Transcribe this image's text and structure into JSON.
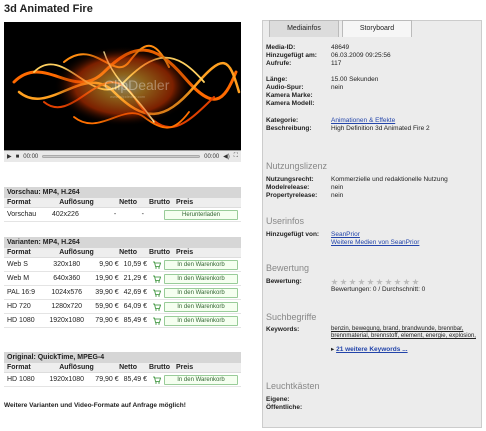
{
  "page_title": "3d Animated Fire",
  "player": {
    "watermark": "ClipDealer",
    "watermark_sub": "www.clipdealer.com",
    "time_start": "00:00",
    "time_end": "00:00"
  },
  "preview": {
    "heading": "Vorschau: MP4, H.264",
    "cols": [
      "Format",
      "Auflösung",
      "Netto",
      "Brutto",
      "Preis"
    ],
    "row": {
      "format": "Vorschau",
      "res": "402x226",
      "netto": "-",
      "brutto": "-",
      "btn": "Herunterladen"
    }
  },
  "variants": {
    "heading": "Varianten: MP4, H.264",
    "cols": [
      "Format",
      "Auflösung",
      "Netto",
      "Brutto",
      "Preis"
    ],
    "rows": [
      {
        "format": "Web S",
        "res": "320x180",
        "netto": "9,90 €",
        "brutto": "10,59 €",
        "btn": "In den Warenkorb"
      },
      {
        "format": "Web M",
        "res": "640x360",
        "netto": "19,90 €",
        "brutto": "21,29 €",
        "btn": "In den Warenkorb"
      },
      {
        "format": "PAL 16:9",
        "res": "1024x576",
        "netto": "39,90 €",
        "brutto": "42,69 €",
        "btn": "In den Warenkorb"
      },
      {
        "format": "HD 720",
        "res": "1280x720",
        "netto": "59,90 €",
        "brutto": "64,09 €",
        "btn": "In den Warenkorb"
      },
      {
        "format": "HD 1080",
        "res": "1920x1080",
        "netto": "79,90 €",
        "brutto": "85,49 €",
        "btn": "In den Warenkorb"
      }
    ]
  },
  "original": {
    "heading": "Original: QuickTime, MPEG-4",
    "cols": [
      "Format",
      "Auflösung",
      "Netto",
      "Brutto",
      "Preis"
    ],
    "row": {
      "format": "HD 1080",
      "res": "1920x1080",
      "netto": "79,90 €",
      "brutto": "85,49 €",
      "btn": "In den Warenkorb"
    }
  },
  "footer_note": "Weitere Varianten und Video-Formate auf Anfrage möglich!",
  "tabs": [
    "Mediainfos",
    "Storyboard"
  ],
  "info": {
    "media_id_k": "Media-ID:",
    "media_id_v": "48649",
    "added_k": "Hinzugefügt am:",
    "added_v": "06.03.2009 09:25:56",
    "views_k": "Aufrufe:",
    "views_v": "117",
    "length_k": "Länge:",
    "length_v": "15.00 Sekunden",
    "audio_k": "Audio-Spur:",
    "audio_v": "nein",
    "brand_k": "Kamera Marke:",
    "brand_v": "",
    "model_k": "Kamera Modell:",
    "model_v": "",
    "cat_k": "Kategorie:",
    "cat_v": "Animationen & Effekte",
    "desc_k": "Beschreibung:",
    "desc_v": "High Definition 3d Animated Fire 2"
  },
  "license": {
    "heading": "Nutzungslizenz",
    "use_k": "Nutzungsrecht:",
    "use_v": "Kommerzielle und redaktionelle Nutzung",
    "model_k": "Modelrelease:",
    "model_v": "nein",
    "prop_k": "Propertyrelease:",
    "prop_v": "nein"
  },
  "userinfo": {
    "heading": "Userinfos",
    "by_k": "Hinzugefügt von:",
    "by_v": "SeanPrior",
    "more": "Weitere Medien von SeanPrior"
  },
  "rating": {
    "heading": "Bewertung",
    "k": "Bewertung:",
    "stars": 0,
    "summary": "Bewertungen: 0 / Durchschnitt: 0"
  },
  "keywords": {
    "heading": "Suchbegriffe",
    "k": "Keywords:",
    "list": "benzin, bewegung, brand, brandwunde, brennbar, brennmaterial, brennstoff, element, energie, explosion,",
    "more": "21 weitere Keywords ..."
  },
  "lightbox": {
    "heading": "Leuchtkästen",
    "own_k": "Eigene:",
    "public_k": "Öffentliche:"
  },
  "colors": {
    "panel": "#ececec",
    "header": "#d6d6d6",
    "link": "#2244aa",
    "button_border": "#99cc99"
  }
}
